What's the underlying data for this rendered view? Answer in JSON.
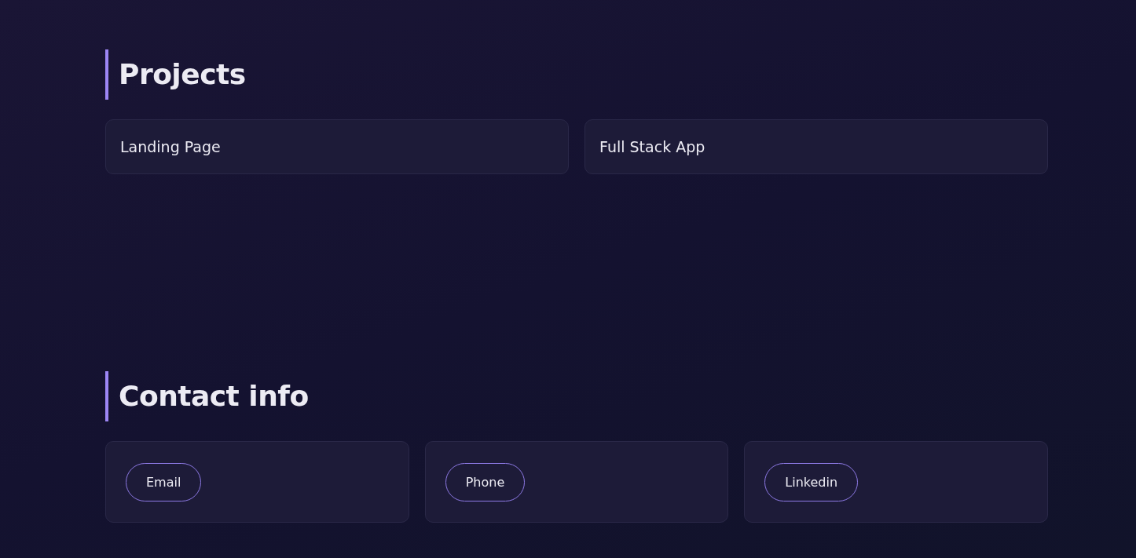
{
  "sections": [
    {
      "title": "Projects",
      "kind": "projects",
      "items": [
        "Landing Page",
        "Full Stack App"
      ]
    },
    {
      "title": "Contact info",
      "kind": "contacts",
      "items": [
        "Email",
        "Phone",
        "Linkedin"
      ]
    }
  ]
}
